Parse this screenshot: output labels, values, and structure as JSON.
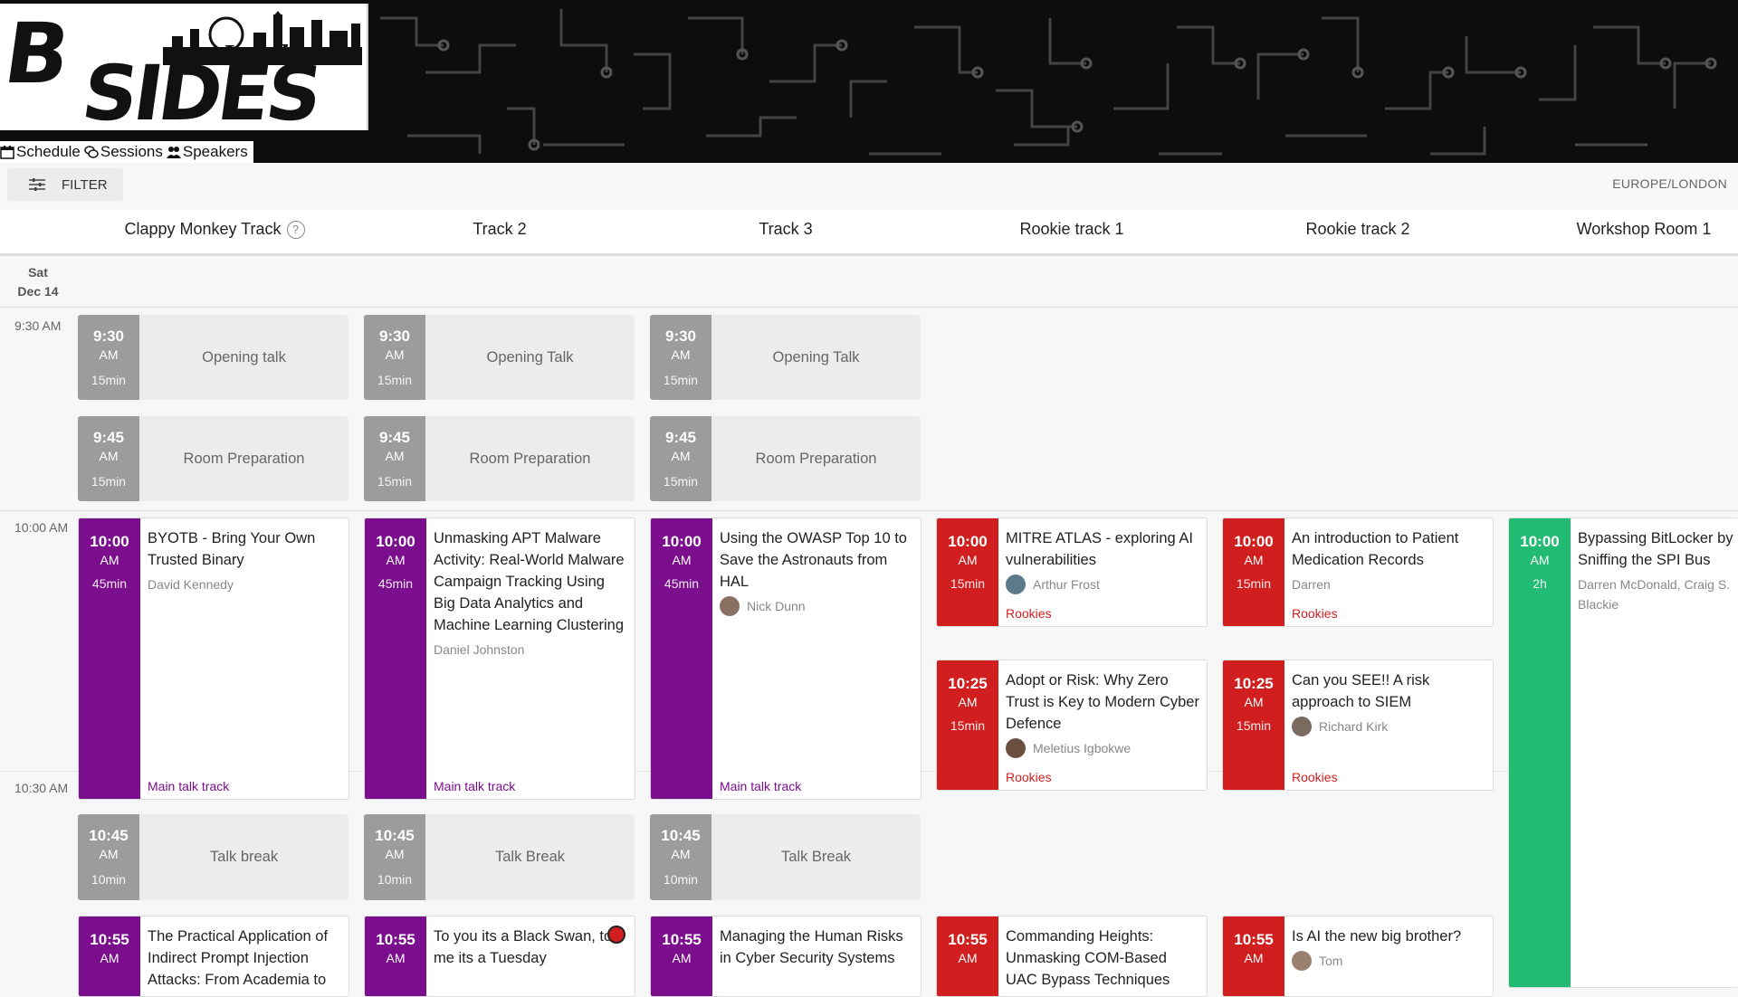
{
  "logo": {
    "brand_b": "B",
    "brand_sides": "SIDES",
    "city": "London"
  },
  "nav": {
    "items": [
      "Schedule",
      "Sessions",
      "Speakers"
    ]
  },
  "toolbar": {
    "filter_label": "FILTER",
    "timezone": "EUROPE/LONDON"
  },
  "tracks": [
    "Clappy Monkey Track",
    "Track 2",
    "Track 3",
    "Rookie track 1",
    "Rookie track 2",
    "Workshop Room 1"
  ],
  "day": {
    "dow": "Sat",
    "date": "Dec 14"
  },
  "time_labels": [
    "9:30 AM",
    "10:00 AM",
    "10:30 AM"
  ],
  "colors": {
    "main_talk": "#7a0e8c",
    "rookies": "#d11f1f",
    "workshop": "#22bb73",
    "break": "#9c9c9c"
  },
  "breaks": {
    "opening": {
      "time": "9:30",
      "ampm": "AM",
      "dur": "15min",
      "labels": [
        "Opening talk",
        "Opening Talk",
        "Opening Talk"
      ]
    },
    "prep": {
      "time": "9:45",
      "ampm": "AM",
      "dur": "15min",
      "label": "Room Preparation"
    },
    "talkbreak": {
      "time": "10:45",
      "ampm": "AM",
      "dur": "10min",
      "labels": [
        "Talk break",
        "Talk Break",
        "Talk Break"
      ]
    }
  },
  "sessions": {
    "t1_1000": {
      "time": "10:00",
      "ampm": "AM",
      "dur": "45min",
      "title": "BYOTB - Bring Your Own Trusted Binary",
      "speaker": "David Kennedy",
      "tag": "Main talk track"
    },
    "t2_1000": {
      "time": "10:00",
      "ampm": "AM",
      "dur": "45min",
      "title": "Unmasking APT Malware Activity: Real-World Malware Campaign Tracking Using Big Data Analytics and Machine Learning Clustering",
      "speaker": "Daniel Johnston",
      "tag": "Main talk track"
    },
    "t3_1000": {
      "time": "10:00",
      "ampm": "AM",
      "dur": "45min",
      "title": "Using the OWASP Top 10 to Save the Astronauts from HAL",
      "speaker": "Nick Dunn",
      "tag": "Main talk track"
    },
    "r1_1000": {
      "time": "10:00",
      "ampm": "AM",
      "dur": "15min",
      "title": "MITRE ATLAS - exploring AI vulnerabilities",
      "speaker": "Arthur Frost",
      "tag": "Rookies"
    },
    "r2_1000": {
      "time": "10:00",
      "ampm": "AM",
      "dur": "15min",
      "title": "An introduction to Patient Medication Records",
      "speaker": "Darren",
      "tag": "Rookies"
    },
    "w1_1000": {
      "time": "10:00",
      "ampm": "AM",
      "dur": "2h",
      "title": "Bypassing BitLocker by Sniffing the SPI Bus",
      "speaker": "Darren McDonald, Craig S. Blackie"
    },
    "r1_1025": {
      "time": "10:25",
      "ampm": "AM",
      "dur": "15min",
      "title": "Adopt or Risk: Why Zero Trust is Key to Modern Cyber Defence",
      "speaker": "Meletius Igbokwe",
      "tag": "Rookies"
    },
    "r2_1025": {
      "time": "10:25",
      "ampm": "AM",
      "dur": "15min",
      "title": "Can you SEE!! A risk approach to SIEM",
      "speaker": "Richard Kirk",
      "tag": "Rookies"
    },
    "t1_1055": {
      "time": "10:55",
      "ampm": "AM",
      "title": "The Practical Application of Indirect Prompt Injection Attacks: From Academia to"
    },
    "t2_1055": {
      "time": "10:55",
      "ampm": "AM",
      "title": "To you its a Black Swan, to me its a Tuesday"
    },
    "t3_1055": {
      "time": "10:55",
      "ampm": "AM",
      "title": "Managing the Human Risks in Cyber Security Systems"
    },
    "r1_1055": {
      "time": "10:55",
      "ampm": "AM",
      "title": "Commanding Heights: Unmasking COM-Based UAC Bypass Techniques"
    },
    "r2_1055": {
      "time": "10:55",
      "ampm": "AM",
      "title": "Is AI the new big brother?",
      "speaker": "Tom"
    }
  }
}
